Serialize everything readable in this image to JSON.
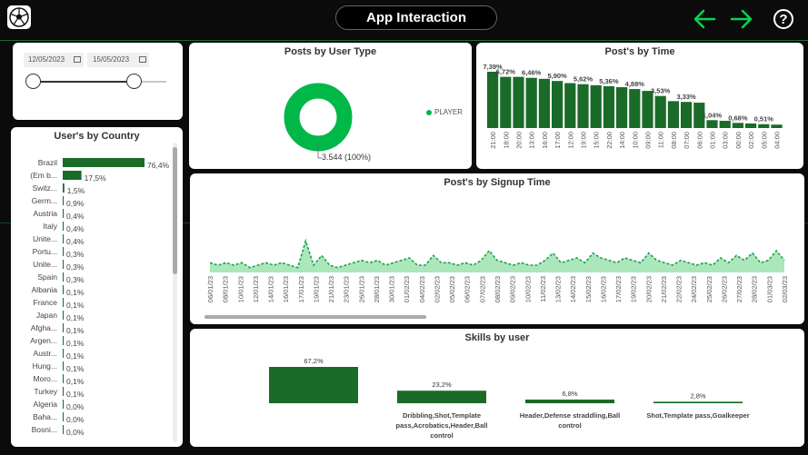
{
  "header": {
    "title": "App Interaction",
    "logo_icon": "soccer-ball-icon",
    "back_icon": "arrow-left-icon",
    "forward_icon": "arrow-right-icon",
    "help_icon": "question-mark-icon",
    "accent_color": "#00c853"
  },
  "date_filter": {
    "start_date": "12/05/2023",
    "end_date": "15/05/2023",
    "range_position": [
      0,
      1
    ]
  },
  "posts_by_user_type": {
    "title": "Posts by User Type",
    "segments": [
      {
        "name": "PLAYER",
        "value": 3544,
        "pct": 100,
        "color": "#00b848"
      }
    ],
    "slice_label": "3.544 (100%)",
    "legend_label": "PLAYER"
  },
  "posts_by_time": {
    "title": "Post's by Time",
    "color": "#1a6b27",
    "categories": [
      "21:00",
      "18:00",
      "20:00",
      "13:00",
      "16:00",
      "17:00",
      "12:00",
      "19:00",
      "15:00",
      "22:00",
      "14:00",
      "10:00",
      "09:00",
      "11:00",
      "08:00",
      "07:00",
      "06:00",
      "01:00",
      "03:00",
      "00:00",
      "02:00",
      "05:00",
      "04:00"
    ],
    "values": [
      7.39,
      6.72,
      6.72,
      6.59,
      6.46,
      6.18,
      5.9,
      5.76,
      5.62,
      5.49,
      5.36,
      5.12,
      4.88,
      4.21,
      3.53,
      3.43,
      3.33,
      1.04,
      0.95,
      0.68,
      0.6,
      0.51,
      0.45
    ],
    "labels": [
      "7,39%",
      "6,72%",
      "",
      "6,46%",
      "",
      "5,90%",
      "",
      "5,62%",
      "",
      "5,36%",
      "",
      "4,88%",
      "",
      "3,53%",
      "",
      "3,33%",
      "",
      "1,04%",
      "",
      "0,68%",
      "",
      "0,51%",
      ""
    ]
  },
  "users_by_country": {
    "title": "User's by Country",
    "color": "#1a6b27",
    "rows": [
      {
        "name": "Brazil",
        "value": 76.4,
        "label": "76,4%"
      },
      {
        "name": "(Em b...",
        "value": 17.5,
        "label": "17,5%"
      },
      {
        "name": "Switz...",
        "value": 1.5,
        "label": "1,5%"
      },
      {
        "name": "Germ...",
        "value": 0.9,
        "label": "0,9%"
      },
      {
        "name": "Austria",
        "value": 0.4,
        "label": "0,4%"
      },
      {
        "name": "Italy",
        "value": 0.4,
        "label": "0,4%"
      },
      {
        "name": "Unite...",
        "value": 0.4,
        "label": "0,4%"
      },
      {
        "name": "Portu...",
        "value": 0.3,
        "label": "0,3%"
      },
      {
        "name": "Unite...",
        "value": 0.3,
        "label": "0,3%"
      },
      {
        "name": "Spain",
        "value": 0.3,
        "label": "0,3%"
      },
      {
        "name": "Albania",
        "value": 0.1,
        "label": "0,1%"
      },
      {
        "name": "France",
        "value": 0.1,
        "label": "0,1%"
      },
      {
        "name": "Japan",
        "value": 0.1,
        "label": "0,1%"
      },
      {
        "name": "Afgha...",
        "value": 0.1,
        "label": "0,1%"
      },
      {
        "name": "Argen...",
        "value": 0.1,
        "label": "0,1%"
      },
      {
        "name": "Austr...",
        "value": 0.1,
        "label": "0,1%"
      },
      {
        "name": "Hung...",
        "value": 0.1,
        "label": "0,1%"
      },
      {
        "name": "Moro...",
        "value": 0.1,
        "label": "0,1%"
      },
      {
        "name": "Turkey",
        "value": 0.1,
        "label": "0,1%"
      },
      {
        "name": "Algeria",
        "value": 0.0,
        "label": "0,0%"
      },
      {
        "name": "Baha...",
        "value": 0.0,
        "label": "0,0%"
      },
      {
        "name": "Bosni...",
        "value": 0.0,
        "label": "0,0%"
      }
    ]
  },
  "posts_by_signup": {
    "title": "Post's by Signup Time",
    "line_color": "#1aa34a",
    "fill_color": "#9de3b0",
    "ylim": [
      0,
      30
    ],
    "x": [
      "06/01/23",
      "08/01/23",
      "10/01/23",
      "12/01/23",
      "14/01/23",
      "16/01/23",
      "17/01/23",
      "19/01/23",
      "21/01/23",
      "23/01/23",
      "26/01/23",
      "28/01/23",
      "30/01/23",
      "01/02/23",
      "04/02/23",
      "02/02/23",
      "05/02/23",
      "06/02/23",
      "07/02/23",
      "08/02/23",
      "09/02/23",
      "10/02/23",
      "11/02/23",
      "13/02/23",
      "14/02/23",
      "15/02/23",
      "16/02/23",
      "17/02/23",
      "19/02/23",
      "20/02/23",
      "21/02/23",
      "22/02/23",
      "24/02/23",
      "25/02/23",
      "26/02/23",
      "27/02/23",
      "28/02/23",
      "01/03/23",
      "02/03/23"
    ],
    "values": [
      4,
      3,
      4,
      3,
      4,
      2,
      3,
      4,
      3,
      4,
      3,
      2,
      13,
      3,
      7,
      3,
      2,
      3,
      4,
      5,
      4,
      5,
      3,
      4,
      5,
      6,
      3,
      3,
      7,
      4,
      4,
      3,
      4,
      3,
      5,
      9,
      5,
      4,
      3,
      4,
      3,
      3,
      5,
      8,
      4,
      5,
      6,
      4,
      8,
      6,
      5,
      4,
      6,
      5,
      4,
      8,
      5,
      4,
      3,
      5,
      4,
      3,
      4,
      3,
      6,
      4,
      7,
      5,
      8,
      4,
      5,
      9,
      5
    ]
  },
  "skills_by_user": {
    "title": "Skills by user",
    "color": "#1a6b27",
    "categories": [
      "",
      "Dribbling,Shot,Template pass,Acrobatics,Header,Ball control",
      "Header,Defense straddling,Ball control",
      "Shot,Template pass,Goalkeeper"
    ],
    "values": [
      67.2,
      23.2,
      6.8,
      2.8
    ],
    "labels": [
      "67,2%",
      "23,2%",
      "6,8%",
      "2,8%"
    ]
  }
}
